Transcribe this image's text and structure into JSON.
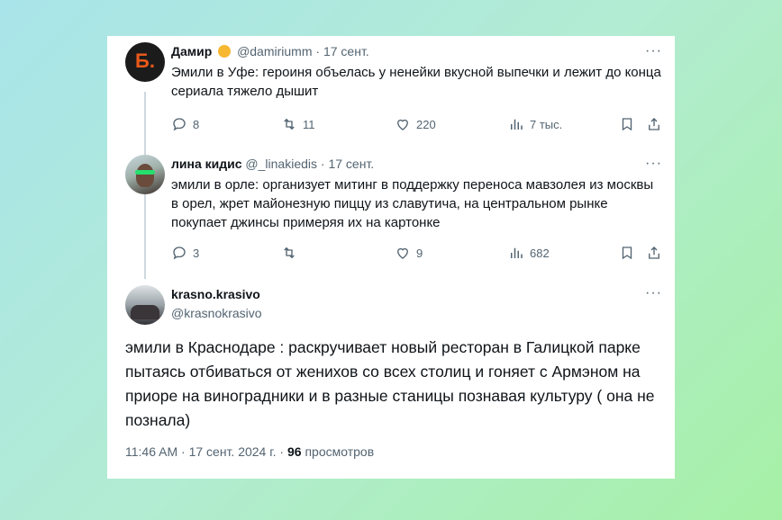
{
  "tweets": [
    {
      "name": "Дамир",
      "handle": "@damiriumm",
      "sep": "·",
      "date": "17 сент.",
      "text": "Эмили в Уфе: героиня объелась у ненейки вкусной выпечки и лежит до конца сериала тяжело дышит",
      "replies": "8",
      "retweets": "11",
      "likes": "220",
      "views": "7 тыс."
    },
    {
      "name": "лина кидис",
      "handle": "@_linakiedis",
      "sep": "·",
      "date": "17 сент.",
      "text": "эмили в орле: организует митинг в поддержку переноса мавзолея из москвы в орел, жрет майонезную пиццу из славутича, на центральном рынке покупает джинсы примеряя их на картонке",
      "replies": "3",
      "retweets": "",
      "likes": "9",
      "views": "682"
    }
  ],
  "main_tweet": {
    "name": "krasno.krasivo",
    "handle": "@krasnokrasivo",
    "text": "эмили в Краснодаре : раскручивает новый ресторан в Галицкой парке пытаясь отбиваться от женихов со всех столиц и гоняет с Армэном на приоре на виноградники и в разные станицы познавая культуру ( она не познала)",
    "time": "11:46 AM",
    "date": "17 сент. 2024 г.",
    "sep": "·",
    "views_count": "96",
    "views_label": "просмотров"
  },
  "more_label": "···",
  "avatar_letter": "Б.",
  "colors": {
    "accent_orange": "#e8591a",
    "text_primary": "#0f1419",
    "text_secondary": "#536471"
  },
  "icons": [
    "reply-icon",
    "retweet-icon",
    "like-icon",
    "views-icon",
    "bookmark-icon",
    "share-icon",
    "more-icon"
  ]
}
